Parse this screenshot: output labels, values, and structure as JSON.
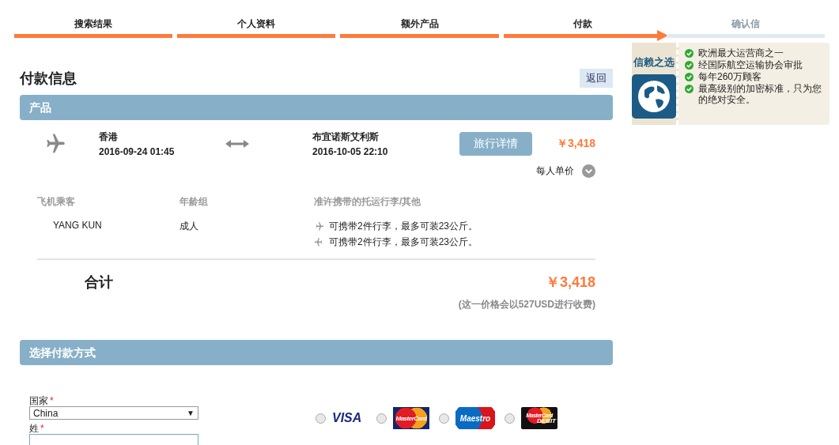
{
  "steps": [
    {
      "label": "搜索结果",
      "completed": true,
      "selected": false
    },
    {
      "label": "个人资料",
      "completed": true,
      "selected": false
    },
    {
      "label": "额外产品",
      "completed": true,
      "selected": false
    },
    {
      "label": "付款",
      "completed": true,
      "selected": true
    },
    {
      "label": "确认信",
      "completed": false,
      "selected": false
    }
  ],
  "page_title": "付款信息",
  "back_button": "返回",
  "product_section": {
    "title": "产品",
    "flight": {
      "origin": "香港",
      "depart": "2016-09-24 01:45",
      "destination": "布宜诺斯艾利斯",
      "return": "2016-10-05 22:10",
      "details_button": "旅行详情",
      "price": "￥3,418",
      "per_person": "每人单价"
    },
    "columns": [
      "飞机乘客",
      "年龄组",
      "准许携带的托运行李/其他"
    ],
    "passengers": [
      {
        "name": "YANG KUN",
        "age_group": "成人",
        "baggage": [
          "可携带2件行李，最多可装23公斤。",
          "可携带2件行李，最多可装23公斤。"
        ]
      }
    ],
    "total_label": "合计",
    "total": "￥3,418",
    "note": "(这一价格会以527USD进行收费)"
  },
  "payment_section": {
    "title": "选择付款方式",
    "fields": [
      {
        "label": "国家",
        "required": "*",
        "kind": "select",
        "value": "China",
        "caret": "▼"
      },
      {
        "label": "姓",
        "required": "*",
        "kind": "text"
      }
    ],
    "methods": [
      {
        "kind": "visa",
        "label": "VISA",
        "selected": false
      },
      {
        "kind": "mastercard",
        "label": "MasterCard",
        "selected": false
      },
      {
        "kind": "maestro",
        "label": "Maestro",
        "selected": false
      },
      {
        "kind": "debit",
        "label": "MasterCard",
        "sub": "DEBIT",
        "selected": false
      }
    ]
  },
  "trust": {
    "title": "信赖之选",
    "points": [
      "欧洲最大运营商之一",
      "经国际航空运输协会审批",
      "每年260万顾客",
      "最高级别的加密标准，只为您的绝对安全。"
    ]
  }
}
